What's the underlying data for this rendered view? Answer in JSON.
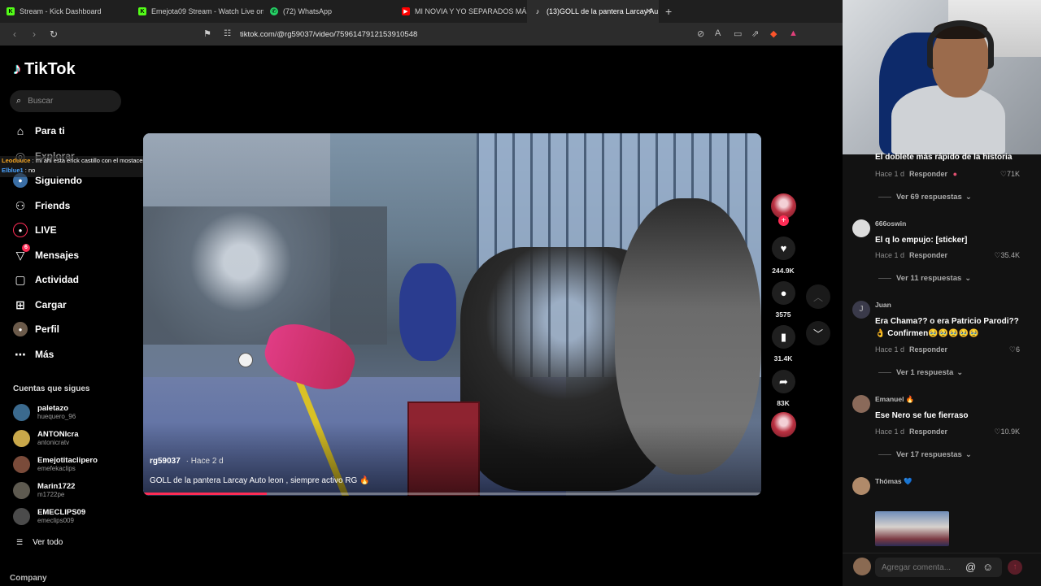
{
  "browser": {
    "tabs": [
      {
        "label": "Stream - Kick Dashboard",
        "icon": "kick-icon",
        "color": "#53fc18"
      },
      {
        "label": "Emejota09 Stream - Watch Live on Ki",
        "icon": "kick-icon",
        "color": "#53fc18"
      },
      {
        "label": "(72) WhatsApp",
        "icon": "whatsapp-icon",
        "color": "#25d366"
      },
      {
        "label": "MI NOVIA Y YO SEPARADOS MÁS QUE",
        "icon": "youtube-icon",
        "color": "#ff0000"
      },
      {
        "label": "(13)GOLL de la pantera Larcay Au",
        "icon": "tiktok-icon",
        "color": "#ffffff"
      }
    ],
    "url": "tiktok.com/@rg59037/video/7596147912153910548"
  },
  "sidebar": {
    "logo": "TikTok",
    "search_placeholder": "Buscar",
    "menu": [
      {
        "label": "Para ti",
        "icon": "home-icon"
      },
      {
        "label": "Explorar",
        "icon": "compass-icon"
      },
      {
        "label": "Siguiendo",
        "icon": "following-icon"
      },
      {
        "label": "Friends",
        "icon": "friends-icon"
      },
      {
        "label": "LIVE",
        "icon": "live-icon"
      },
      {
        "label": "Mensajes",
        "icon": "messages-icon",
        "badge": "6"
      },
      {
        "label": "Actividad",
        "icon": "activity-icon"
      },
      {
        "label": "Cargar",
        "icon": "upload-icon"
      },
      {
        "label": "Perfil",
        "icon": "profile-icon"
      },
      {
        "label": "Más",
        "icon": "more-icon"
      }
    ],
    "following_title": "Cuentas que sigues",
    "following": [
      {
        "name": "paletazo",
        "handle": "huequero_96"
      },
      {
        "name": "ANTONIcra",
        "handle": "antonicratv"
      },
      {
        "name": "Emejotitaclipero",
        "handle": "emefekaclips"
      },
      {
        "name": "Marin1722",
        "handle": "m1722pe"
      },
      {
        "name": "EMECLIPS09",
        "handle": "emeclips009"
      }
    ],
    "see_all": "Ver todo",
    "company": "Company"
  },
  "chat_overlay": [
    {
      "user": "Leoduuce",
      "text": "mi ahi esta erick castillo con el mostacero de emejota"
    },
    {
      "user": "Elblue1",
      "text": "no"
    }
  ],
  "video": {
    "author": "rg59037",
    "time": "· Hace 2 d",
    "caption": "GOLL de la pantera Larcay Auto leon , siempre activo RG 🔥",
    "progress": 0.2
  },
  "actions": {
    "likes": "244.9K",
    "comments": "3575",
    "saves": "31.4K",
    "shares": "83K"
  },
  "comments": [
    {
      "user": "",
      "text": "El doblete más rápido de la historia",
      "time": "Hace 1 d",
      "reply": "Responder",
      "likes": "71K",
      "replies": "Ver 69 respuestas"
    },
    {
      "user": "666oswin",
      "text": "El q lo empujo: [sticker]",
      "time": "Hace 1 d",
      "reply": "Responder",
      "likes": "35.4K",
      "replies": "Ver 11 respuestas"
    },
    {
      "user": "Juan",
      "text": "Era Chama?? o era Patricio Parodi?? 👌 Confirmen🥹🥹🥹🥹🥹",
      "time": "Hace 1 d",
      "reply": "Responder",
      "likes": "6",
      "replies": "Ver 1 respuesta"
    },
    {
      "user": "Emanuel 🔥",
      "text": "Ese Nero se fue fierraso",
      "time": "Hace 1 d",
      "reply": "Responder",
      "likes": "10.9K",
      "replies": "Ver 17 respuestas"
    },
    {
      "user": "Thómas 💙",
      "text": "",
      "time": "",
      "reply": "",
      "likes": "",
      "replies": ""
    }
  ],
  "comment_input_placeholder": "Agregar comenta...",
  "colors": {
    "accent": "#fe2c55",
    "background": "#000000"
  }
}
